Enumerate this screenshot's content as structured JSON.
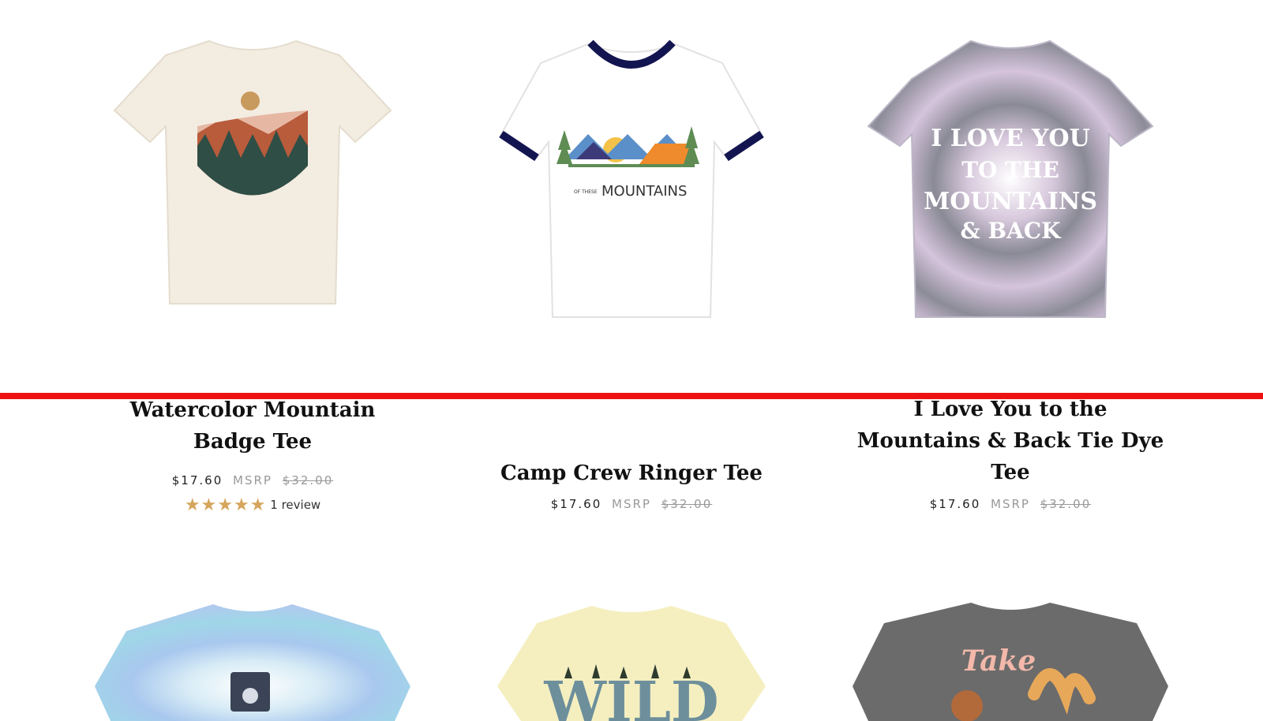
{
  "products": [
    {
      "title_lines": [
        "Watercolor Mountain",
        "Badge Tee"
      ],
      "price": "$17.60",
      "msrp_label": "MSRP",
      "orig_price": "$32.00",
      "review_text": "1 review",
      "stars": 5,
      "shirt_color": "#f3ece1",
      "image_icon": "watercolor-mountain-badge-image"
    },
    {
      "title_lines": [
        "Camp Crew Ringer Tee"
      ],
      "price": "$17.60",
      "msrp_label": "MSRP",
      "orig_price": "$32.00",
      "shirt_color": "#ffffff",
      "trim_color": "#131550",
      "graphic_text_small": "OF THESE",
      "graphic_text": "MOUNTAINS",
      "image_icon": "camp-crew-ringer-image"
    },
    {
      "title_lines": [
        "I Love You to the",
        "Mountains & Back Tie Dye",
        "Tee"
      ],
      "price": "$17.60",
      "msrp_label": "MSRP",
      "orig_price": "$32.00",
      "shirt_color": "#a6a3b6",
      "graphic_lines": [
        "I LOVE YOU",
        "TO THE",
        "MOUNTAINS",
        "& BACK"
      ],
      "image_icon": "tie-dye-mountains-image"
    },
    {
      "shirt_color": "#b4d3ee",
      "image_icon": "tie-dye-jeep-image"
    },
    {
      "shirt_color": "#f5efc0",
      "graphic_text": "WILD",
      "image_icon": "wild-tee-image"
    },
    {
      "shirt_color": "#6b6b6b",
      "graphic_text": "Take",
      "image_icon": "take-tee-image"
    }
  ],
  "colors": {
    "accent_divider": "#ee1111",
    "star": "#d6a55c"
  }
}
